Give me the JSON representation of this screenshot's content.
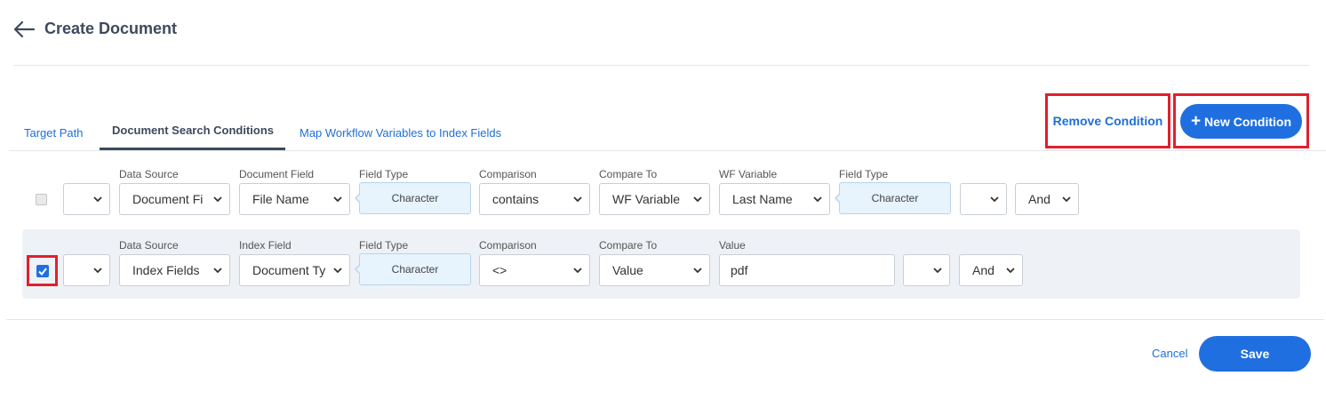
{
  "header": {
    "title": "Create Document"
  },
  "tabs": [
    {
      "label": "Target Path"
    },
    {
      "label": "Document Search Conditions"
    },
    {
      "label": "Map Workflow Variables to Index Fields"
    }
  ],
  "actions": {
    "remove_label": "Remove Condition",
    "new_label": "New Condition",
    "new_icon": "plus-icon"
  },
  "rows": [
    {
      "checked": false,
      "paren_open": "",
      "data_source_label": "Data Source",
      "data_source": "Document Fi",
      "field_label": "Document Field",
      "field": "File Name",
      "field_type_label": "Field Type",
      "field_type": "Character",
      "comparison_label": "Comparison",
      "comparison": "contains",
      "compare_to_label": "Compare To",
      "compare_to": "WF Variable",
      "value_label": "WF Variable",
      "value": "Last Name",
      "value_type_label": "Field Type",
      "value_type": "Character",
      "paren_close": "",
      "conjunction": "And"
    },
    {
      "checked": true,
      "paren_open": "",
      "data_source_label": "Data Source",
      "data_source": "Index Fields",
      "field_label": "Index Field",
      "field": "Document Ty",
      "field_type_label": "Field Type",
      "field_type": "Character",
      "comparison_label": "Comparison",
      "comparison": "<>",
      "compare_to_label": "Compare To",
      "compare_to": "Value",
      "value_label": "Value",
      "value": "pdf",
      "paren_close": "",
      "conjunction": "And"
    }
  ],
  "footer": {
    "cancel_label": "Cancel",
    "save_label": "Save"
  },
  "colors": {
    "accent": "#1f6fe0",
    "highlight": "#e0202e",
    "field_type_bg": "#e7f3fd",
    "row_bg": "#eef1f6"
  }
}
